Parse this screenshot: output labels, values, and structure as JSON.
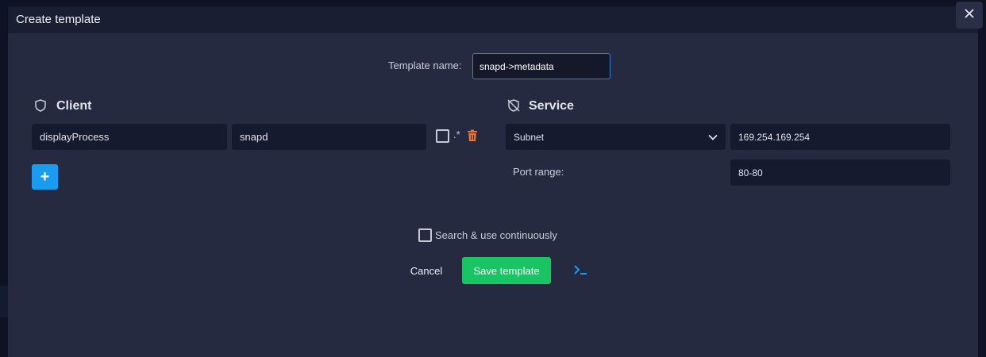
{
  "modal": {
    "title": "Create template"
  },
  "template_name": {
    "label": "Template name:",
    "value": "snapd->metadata"
  },
  "client": {
    "title": "Client",
    "rows": [
      {
        "key": "displayProcess",
        "value": "snapd",
        "regex_checked": false,
        "regex_label": ".*"
      }
    ],
    "add_label": "+"
  },
  "service": {
    "title": "Service",
    "type_selected": "Subnet",
    "address": "169.254.169.254",
    "port_label": "Port range:",
    "port_value": "80-80"
  },
  "options": {
    "continuous_label": "Search & use continuously",
    "continuous_checked": false
  },
  "actions": {
    "cancel": "Cancel",
    "save": "Save template"
  },
  "colors": {
    "accent_blue": "#1a9bf0",
    "save_green": "#19c464",
    "trash_orange": "#e8762d",
    "modal_bg": "#252a41"
  }
}
